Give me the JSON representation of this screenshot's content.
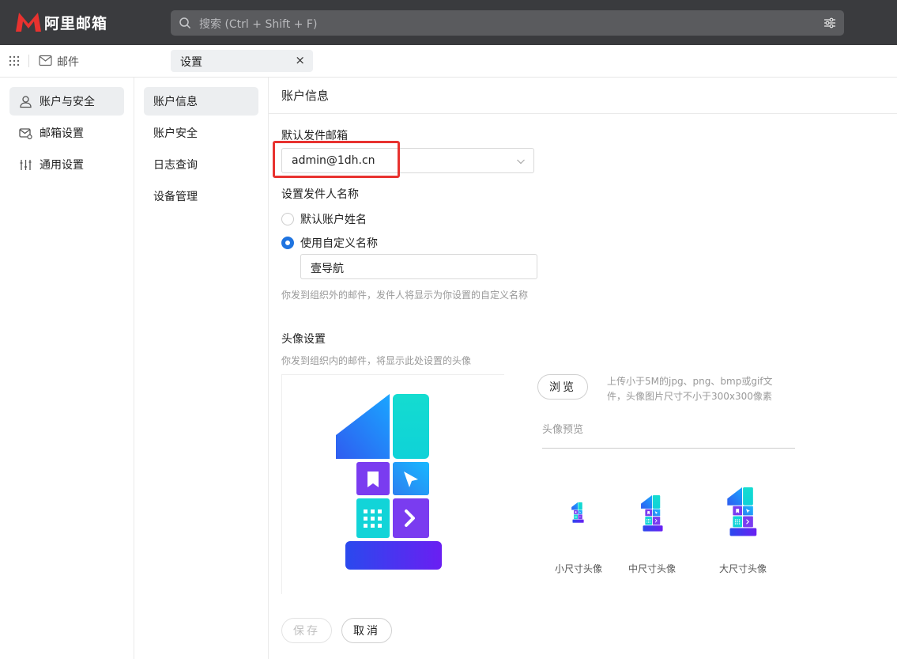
{
  "app": {
    "logo_text": "阿里邮箱",
    "brand_color": "#e8322f"
  },
  "search": {
    "placeholder": "搜索 (Ctrl + Shift + F)"
  },
  "tabbar": {
    "mail_label": "邮件",
    "active_tab": "设置",
    "close_glyph": "×"
  },
  "sidebar": {
    "items": [
      {
        "label": "账户与安全",
        "icon": "user-icon",
        "active": true
      },
      {
        "label": "邮箱设置",
        "icon": "mailbox-settings-icon",
        "active": false
      },
      {
        "label": "通用设置",
        "icon": "sliders-icon",
        "active": false
      }
    ]
  },
  "subnav": {
    "items": [
      {
        "label": "账户信息",
        "active": true
      },
      {
        "label": "账户安全",
        "active": false
      },
      {
        "label": "日志查询",
        "active": false
      },
      {
        "label": "设备管理",
        "active": false
      }
    ]
  },
  "main": {
    "title": "账户信息",
    "default_sender_label": "默认发件邮箱",
    "default_sender_value": "admin@1dh.cn",
    "sender_name_label": "设置发件人名称",
    "radio_default": "默认账户姓名",
    "radio_custom": "使用自定义名称",
    "custom_name_value": "壹导航",
    "custom_name_hint": "你发到组织外的邮件，发件人将显示为你设置的自定义名称",
    "avatar_label": "头像设置",
    "avatar_hint": "你发到组织内的邮件，将显示此处设置的头像",
    "browse_button": "浏览",
    "upload_hint": "上传小于5M的jpg、png、bmp或gif文件，头像图片尺寸不小于300x300像素",
    "preview_title": "头像预览",
    "preview_small": "小尺寸头像",
    "preview_medium": "中尺寸头像",
    "preview_large": "大尺寸头像",
    "save_button": "保存",
    "cancel_button": "取消"
  },
  "colors": {
    "topbar": "#3a3b3e",
    "accent_blue": "#1f74e0",
    "highlight_red": "#e8322f"
  }
}
